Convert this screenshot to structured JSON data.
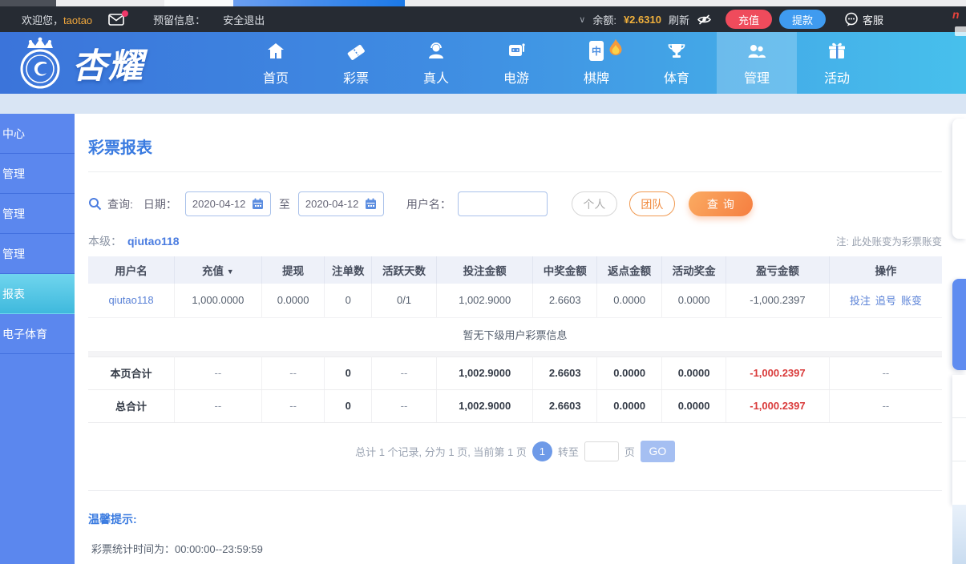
{
  "topbar": {
    "welcome_prefix": "欢迎您，",
    "username": "taotao",
    "reserved_label": "预留信息：",
    "logout_label": "安全退出",
    "chevron": "∨",
    "balance_label": "余额:",
    "balance_value": "¥2.6310",
    "refresh_label": "刷新",
    "deposit_label": "充值",
    "withdraw_label": "提款",
    "service_label": "客服",
    "colors": {
      "accent_yellow": "#f0b03c",
      "deposit_red": "#ef4b5c",
      "withdraw_blue": "#3f9bf0"
    }
  },
  "nav": {
    "logo_text": "杏耀",
    "items": [
      {
        "label": "首页",
        "icon": "home-icon"
      },
      {
        "label": "彩票",
        "icon": "ticket-icon"
      },
      {
        "label": "真人",
        "icon": "person-icon"
      },
      {
        "label": "电游",
        "icon": "slot-machine-icon"
      },
      {
        "label": "棋牌",
        "icon": "mahjong-icon",
        "hot": true
      },
      {
        "label": "体育",
        "icon": "trophy-icon"
      },
      {
        "label": "管理",
        "icon": "users-icon",
        "active": true
      },
      {
        "label": "活动",
        "icon": "gift-icon"
      }
    ],
    "gradient": [
      "#3b74da",
      "#47c0ec"
    ]
  },
  "sidebar": {
    "items": [
      {
        "label": "中心"
      },
      {
        "label": "管理"
      },
      {
        "label": "管理"
      },
      {
        "label": "管理"
      },
      {
        "label": "报表",
        "active": true
      },
      {
        "label": "电子体育"
      }
    ]
  },
  "main": {
    "title": "彩票报表",
    "search": {
      "query_label": "查询:",
      "date_label": "日期：",
      "date_from": "2020-04-12",
      "to_label": "至",
      "date_to": "2020-04-12",
      "username_label": "用户名：",
      "username_value": "",
      "personal_btn": "个人",
      "team_btn": "团队",
      "query_btn": "查询"
    },
    "level_label": "本级：",
    "level_user": "qiutao118",
    "note": "注: 此处账变为彩票账变",
    "table": {
      "headers": [
        "用户名",
        "充值",
        "提现",
        "注单数",
        "活跃天数",
        "投注金额",
        "中奖金额",
        "返点金额",
        "活动奖金",
        "盈亏金额",
        "操作"
      ],
      "sort_indicator": "▼",
      "row": {
        "username": "qiutao118",
        "recharge": "1,000.0000",
        "withdraw": "0.0000",
        "orders": "0",
        "active_days": "0/1",
        "bet": "1,002.9000",
        "win": "2.6603",
        "rebate": "0.0000",
        "activity": "0.0000",
        "profit": "-1,000.2397",
        "ops": [
          "投注",
          "追号",
          "账变"
        ]
      },
      "empty_message": "暂无下级用户彩票信息",
      "page_total": {
        "cells": [
          "本页合计",
          "--",
          "--",
          "0",
          "--",
          "1,002.9000",
          "2.6603",
          "0.0000",
          "0.0000",
          "-1,000.2397",
          "--"
        ]
      },
      "grand_total": {
        "cells": [
          "总合计",
          "--",
          "--",
          "0",
          "--",
          "1,002.9000",
          "2.6603",
          "0.0000",
          "0.0000",
          "-1,000.2397",
          "--"
        ]
      }
    },
    "pagination": {
      "summary": "总计 1 个记录, 分为 1 页, 当前第 1 页",
      "current_page": "1",
      "goto_label": "转至",
      "page_unit": "页",
      "go_btn": "GO"
    },
    "tips": {
      "title": "温馨提示:",
      "line": "彩票统计时间为：00:00:00--23:59:59"
    }
  }
}
